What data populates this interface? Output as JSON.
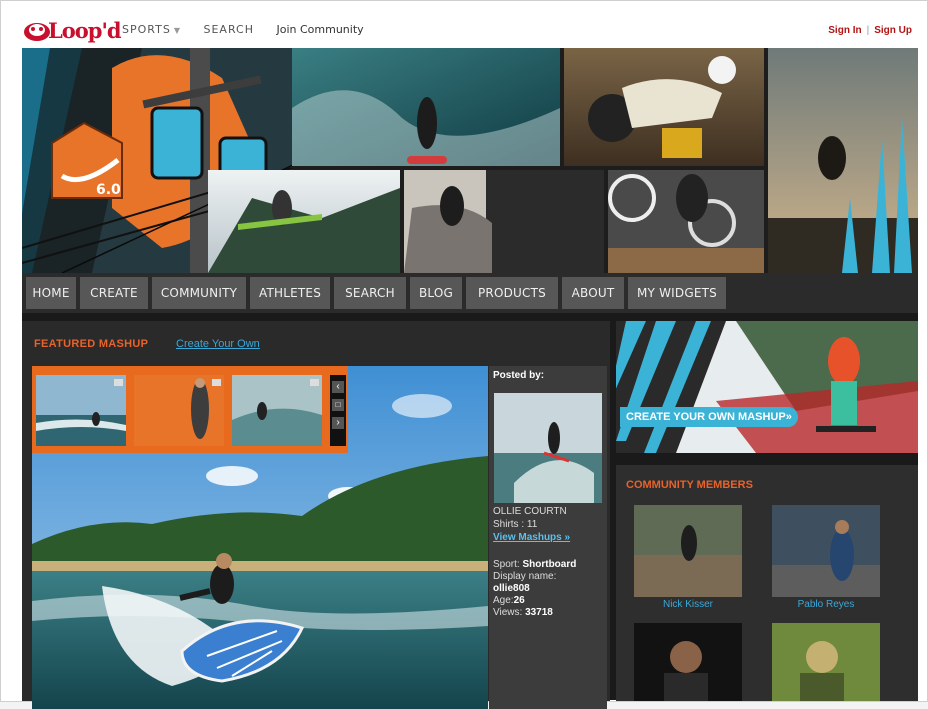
{
  "topbar": {
    "logo_text": "Loop'd",
    "nav": [
      "SPORTS",
      "SEARCH",
      "Join Community"
    ],
    "sign_in": "Sign In",
    "sign_up": "Sign Up"
  },
  "banner": {
    "badge": "6.0"
  },
  "main_nav": [
    "HOME",
    "CREATE",
    "COMMUNITY",
    "ATHLETES",
    "SEARCH",
    "BLOG",
    "PRODUCTS",
    "ABOUT",
    "MY WIDGETS"
  ],
  "featured": {
    "heading": "FEATURED MASHUP",
    "create_link": "Create Your Own",
    "posted_by_label": "Posted by:",
    "poster_name": "OLLIE COURTN",
    "poster_line": "Shirts : 11",
    "view_link": "View Mashups »",
    "sport_label": "Sport:",
    "sport_value": "Shortboard",
    "display_label": "Display name:",
    "display_value": "ollie808",
    "age_label": "Age:",
    "age_value": "26",
    "views_label": "Views:",
    "views_value": "33718",
    "strip_controls": [
      "‹",
      "□",
      "›"
    ]
  },
  "ad": {
    "button": "CREATE YOUR OWN MASHUP»"
  },
  "community": {
    "heading": "COMMUNITY MEMBERS",
    "members": [
      {
        "name": "Nick Kisser"
      },
      {
        "name": "Pablo Reyes"
      },
      {
        "name": ""
      },
      {
        "name": ""
      }
    ]
  },
  "colors": {
    "accent": "#e8622a",
    "brand_red": "#c8102e",
    "link_blue": "#3aa8d8",
    "nav_gray": "#575757"
  }
}
